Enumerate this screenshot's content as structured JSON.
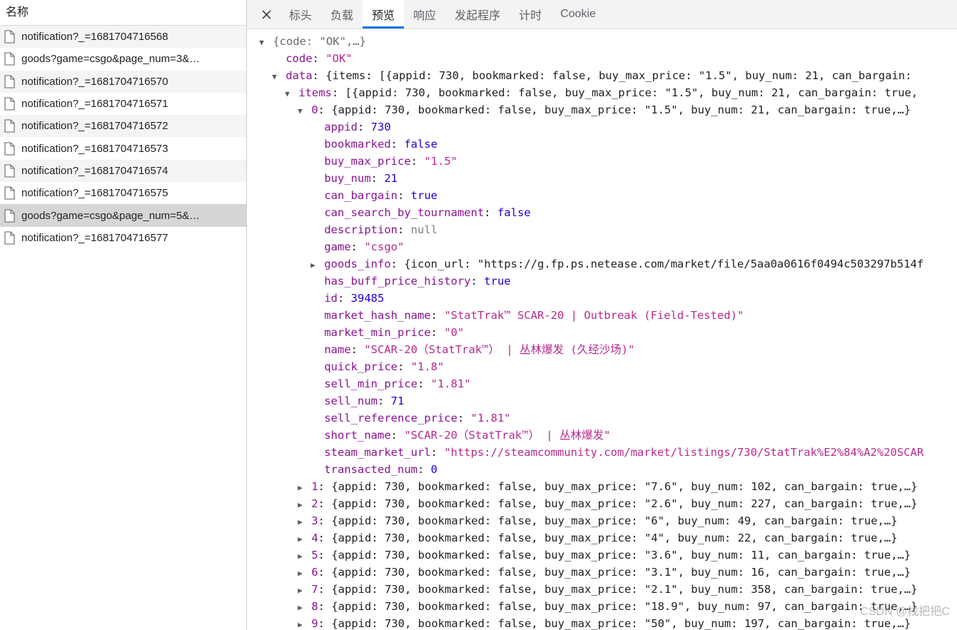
{
  "request_panel": {
    "column_header": "名称",
    "rows": [
      {
        "label": "notification?_=1681704716568",
        "selected": false,
        "striped": true
      },
      {
        "label": "goods?game=csgo&page_num=3&…",
        "selected": false,
        "striped": false
      },
      {
        "label": "notification?_=1681704716570",
        "selected": false,
        "striped": true
      },
      {
        "label": "notification?_=1681704716571",
        "selected": false,
        "striped": false
      },
      {
        "label": "notification?_=1681704716572",
        "selected": false,
        "striped": true
      },
      {
        "label": "notification?_=1681704716573",
        "selected": false,
        "striped": false
      },
      {
        "label": "notification?_=1681704716574",
        "selected": false,
        "striped": true
      },
      {
        "label": "notification?_=1681704716575",
        "selected": false,
        "striped": false
      },
      {
        "label": "goods?game=csgo&page_num=5&…",
        "selected": true,
        "striped": true
      },
      {
        "label": "notification?_=1681704716577",
        "selected": false,
        "striped": false
      }
    ]
  },
  "tabbar": {
    "close_label": "✕",
    "tabs": [
      {
        "label": "标头",
        "active": false
      },
      {
        "label": "负载",
        "active": false
      },
      {
        "label": "预览",
        "active": true
      },
      {
        "label": "响应",
        "active": false
      },
      {
        "label": "发起程序",
        "active": false
      },
      {
        "label": "计时",
        "active": false
      },
      {
        "label": "Cookie",
        "active": false
      }
    ],
    "accent_color": "#1a73e8"
  },
  "preview": {
    "root_summary": "{code: \"OK\",…}",
    "code_key": "code",
    "code_value": "\"OK\"",
    "data_key": "data",
    "data_summary": "{items: [{appid: 730, bookmarked: false, buy_max_price: \"1.5\", buy_num: 21, can_bargain:",
    "items_key": "items",
    "items_summary": "[{appid: 730, bookmarked: false, buy_max_price: \"1.5\", buy_num: 21, can_bargain: true,",
    "item0_index": "0",
    "item0_summary": "{appid: 730, bookmarked: false, buy_max_price: \"1.5\", buy_num: 21, can_bargain: true,…}",
    "fields": [
      {
        "key": "appid",
        "value": "730",
        "kind": "n"
      },
      {
        "key": "bookmarked",
        "value": "false",
        "kind": "b"
      },
      {
        "key": "buy_max_price",
        "value": "\"1.5\"",
        "kind": "str"
      },
      {
        "key": "buy_num",
        "value": "21",
        "kind": "n"
      },
      {
        "key": "can_bargain",
        "value": "true",
        "kind": "b"
      },
      {
        "key": "can_search_by_tournament",
        "value": "false",
        "kind": "b"
      },
      {
        "key": "description",
        "value": "null",
        "kind": "nul"
      },
      {
        "key": "game",
        "value": "\"csgo\"",
        "kind": "str"
      }
    ],
    "goods_info_key": "goods_info",
    "goods_info_summary": "{icon_url: \"https://g.fp.ps.netease.com/market/file/5aa0a0616f0494c503297b514f",
    "fields2": [
      {
        "key": "has_buff_price_history",
        "value": "true",
        "kind": "b"
      },
      {
        "key": "id",
        "value": "39485",
        "kind": "n"
      },
      {
        "key": "market_hash_name",
        "value": "\"StatTrak™ SCAR-20 | Outbreak (Field-Tested)\"",
        "kind": "str"
      },
      {
        "key": "market_min_price",
        "value": "\"0\"",
        "kind": "str"
      },
      {
        "key": "name",
        "value": "\"SCAR-20（StatTrak™） | 丛林爆发 (久经沙场)\"",
        "kind": "str"
      },
      {
        "key": "quick_price",
        "value": "\"1.8\"",
        "kind": "str"
      },
      {
        "key": "sell_min_price",
        "value": "\"1.81\"",
        "kind": "str"
      },
      {
        "key": "sell_num",
        "value": "71",
        "kind": "n"
      },
      {
        "key": "sell_reference_price",
        "value": "\"1.81\"",
        "kind": "str"
      },
      {
        "key": "short_name",
        "value": "\"SCAR-20（StatTrak™） | 丛林爆发\"",
        "kind": "str"
      },
      {
        "key": "steam_market_url",
        "value": "\"https://steamcommunity.com/market/listings/730/StatTrak%E2%84%A2%20SCAR",
        "kind": "str"
      },
      {
        "key": "transacted_num",
        "value": "0",
        "kind": "n"
      }
    ],
    "collapsed_items": [
      {
        "index": "1",
        "summary": "{appid: 730, bookmarked: false, buy_max_price: \"7.6\", buy_num: 102, can_bargain: true,…}"
      },
      {
        "index": "2",
        "summary": "{appid: 730, bookmarked: false, buy_max_price: \"2.6\", buy_num: 227, can_bargain: true,…}"
      },
      {
        "index": "3",
        "summary": "{appid: 730, bookmarked: false, buy_max_price: \"6\", buy_num: 49, can_bargain: true,…}"
      },
      {
        "index": "4",
        "summary": "{appid: 730, bookmarked: false, buy_max_price: \"4\", buy_num: 22, can_bargain: true,…}"
      },
      {
        "index": "5",
        "summary": "{appid: 730, bookmarked: false, buy_max_price: \"3.6\", buy_num: 11, can_bargain: true,…}"
      },
      {
        "index": "6",
        "summary": "{appid: 730, bookmarked: false, buy_max_price: \"3.1\", buy_num: 16, can_bargain: true,…}"
      },
      {
        "index": "7",
        "summary": "{appid: 730, bookmarked: false, buy_max_price: \"2.1\", buy_num: 358, can_bargain: true,…}"
      },
      {
        "index": "8",
        "summary": "{appid: 730, bookmarked: false, buy_max_price: \"18.9\", buy_num: 97, can_bargain: true,…}"
      },
      {
        "index": "9",
        "summary": "{appid: 730, bookmarked: false, buy_max_price: \"50\", buy_num: 197, can_bargain: true,…}"
      }
    ],
    "expanded_glyph": "▼",
    "collapsed_glyph": "▶"
  },
  "watermark": "CSDN @找把把C"
}
